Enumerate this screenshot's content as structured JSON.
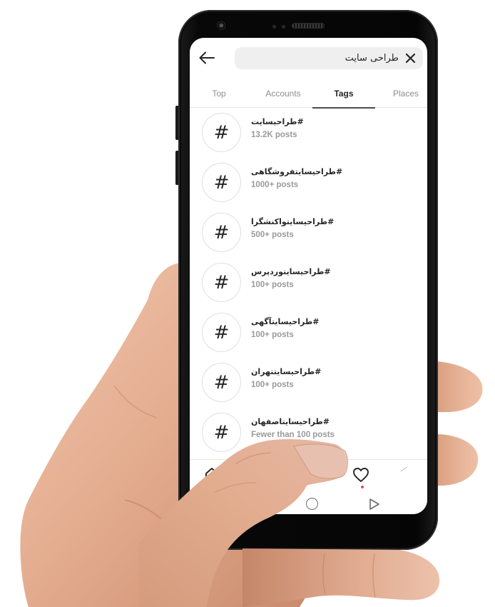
{
  "search": {
    "back_icon": "arrow-left-icon",
    "query": "طراحی سایت",
    "clear_icon": "close-icon"
  },
  "tabs": [
    {
      "label": "Top",
      "active": false
    },
    {
      "label": "Accounts",
      "active": false
    },
    {
      "label": "Tags",
      "active": true
    },
    {
      "label": "Places",
      "active": false
    }
  ],
  "tags": [
    {
      "icon": "#",
      "name": "#طراحیسایت",
      "count": "13.2K posts"
    },
    {
      "icon": "#",
      "name": "#طراحیسایتفروشگاهی",
      "count": "1000+ posts"
    },
    {
      "icon": "#",
      "name": "#طراحیسایتواکنشگرا",
      "count": "500+ posts"
    },
    {
      "icon": "#",
      "name": "#طراحیسایتوردپرس",
      "count": "100+ posts"
    },
    {
      "icon": "#",
      "name": "#طراحیسایتآگهی",
      "count": "100+ posts"
    },
    {
      "icon": "#",
      "name": "#طراحیسایتتهران",
      "count": "100+ posts"
    },
    {
      "icon": "#",
      "name": "#طراحیسایتاصفهان",
      "count": "Fewer than 100 posts"
    }
  ],
  "bottom_nav": {
    "items": [
      "home-icon",
      "heart-icon",
      "profile-icon"
    ],
    "activity_dot_color": "#ed4956"
  },
  "system_nav": {
    "items": [
      "home-circle-icon",
      "back-triangle-icon"
    ]
  },
  "colors": {
    "primary_text": "#262626",
    "secondary_text": "#8e8e8e",
    "search_bg": "#efefef",
    "phone_body": "#050505"
  }
}
